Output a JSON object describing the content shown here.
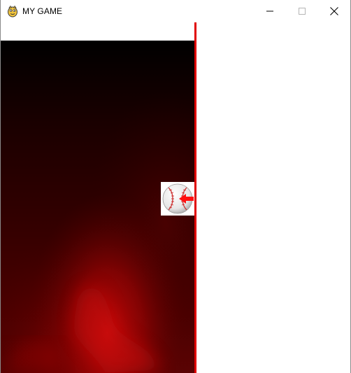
{
  "window": {
    "title": "MY GAME",
    "app_icon": "pygame-snake-icon",
    "controls": {
      "minimize_icon": "minimize-icon",
      "maximize_icon": "maximize-icon",
      "close_icon": "close-icon"
    }
  },
  "game": {
    "background": {
      "style": "dark red smoky gradient",
      "colors": [
        "#000000",
        "#3a0000",
        "#c00000"
      ]
    },
    "divider": {
      "color": "#e00000"
    },
    "ball": {
      "icon": "baseball-icon",
      "arrow_color": "#ff1010",
      "arrow_direction": "right"
    }
  }
}
